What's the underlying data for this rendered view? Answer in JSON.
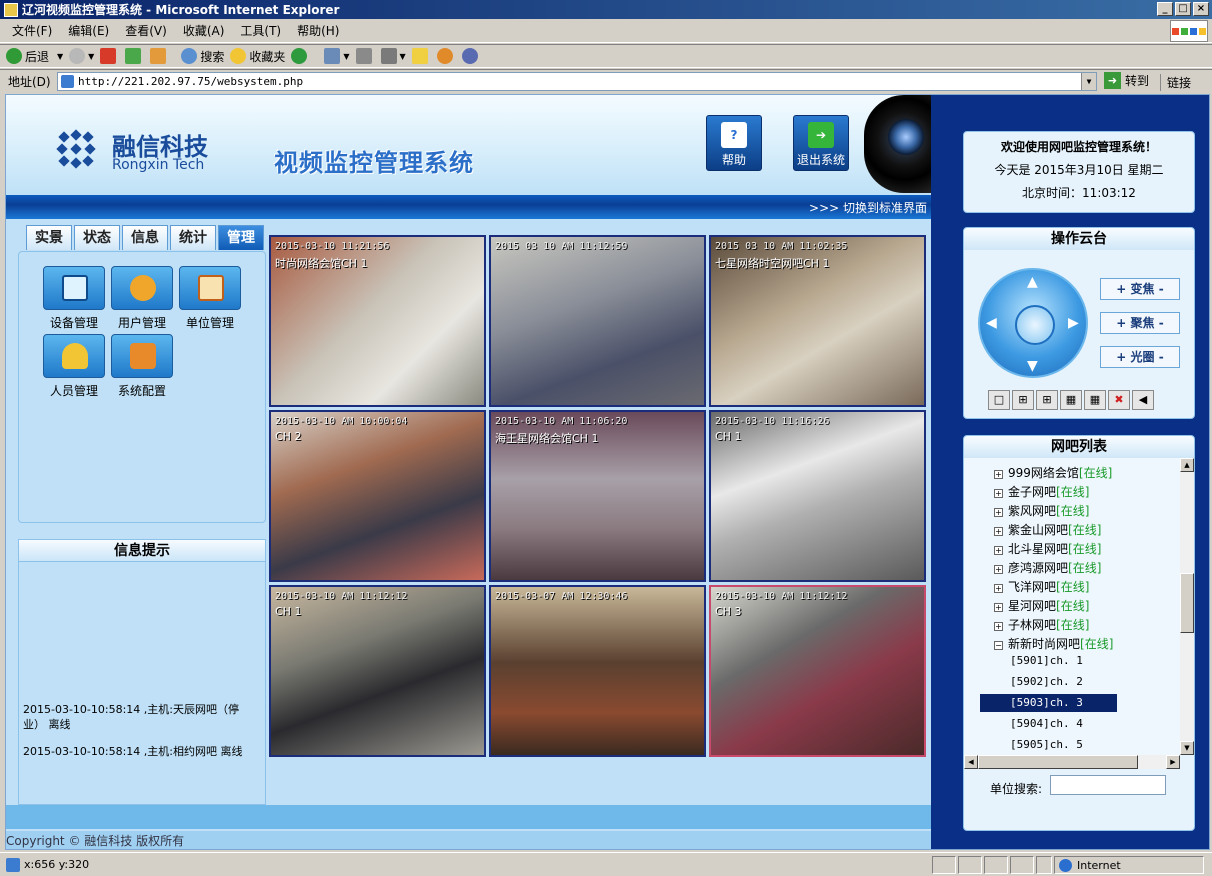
{
  "window": {
    "title": "辽河视频监控管理系统 - Microsoft Internet Explorer"
  },
  "menu": [
    "文件(F)",
    "编辑(E)",
    "查看(V)",
    "收藏(A)",
    "工具(T)",
    "帮助(H)"
  ],
  "toolbar": {
    "back": "后退",
    "search": "搜索",
    "favorites": "收藏夹"
  },
  "address": {
    "label": "地址(D)",
    "url": "http://221.202.97.75/websystem.php",
    "go": "转到",
    "links": "链接"
  },
  "header": {
    "company_cn": "融信科技",
    "company_en": "Rongxin Tech",
    "system_title": "视频监控管理系统",
    "help_label": "帮助",
    "logout_label": "退出系统",
    "switch_link": ">>> 切换到标准界面"
  },
  "tabs": [
    "实景",
    "状态",
    "信息",
    "统计",
    "管理"
  ],
  "tools": [
    {
      "label": "设备管理",
      "icon": "monitor-icon"
    },
    {
      "label": "用户管理",
      "icon": "user-key-icon"
    },
    {
      "label": "单位管理",
      "icon": "house-icon"
    },
    {
      "label": "人员管理",
      "icon": "people-icon"
    },
    {
      "label": "系统配置",
      "icon": "tools-icon"
    }
  ],
  "info": {
    "title": "信息提示",
    "messages": [
      "2015-03-10-10:58:14 ,主机:天辰网吧（停业） 离线",
      "2015-03-10-10:58:14 ,主机:相约网吧 离线"
    ]
  },
  "cameras": [
    {
      "timestamp": "2015-03-10 11:21:56",
      "label": "时尚网络会馆CH 1"
    },
    {
      "timestamp": "2015 03 10 AM 11:12:59",
      "label": ""
    },
    {
      "timestamp": "2015 03 10 AM 11:02:35",
      "label": "七星网络时空网吧CH 1"
    },
    {
      "timestamp": "2015-03-10 AM 10:00:04",
      "label": "CH 2"
    },
    {
      "timestamp": "2015-03-10 AM 11:06:20",
      "label": "海王星网络会馆CH 1"
    },
    {
      "timestamp": "2015-03-10 11:16:26",
      "label": "CH 1"
    },
    {
      "timestamp": "2015-03-10 AM 11:12:12",
      "label": "CH 1"
    },
    {
      "timestamp": "2015-03-07 AM 12:30:46",
      "label": ""
    },
    {
      "timestamp": "2015-03-10 AM 11:12:12",
      "label": "CH 3"
    }
  ],
  "copyright": "Copyright © 融信科技  版权所有",
  "welcome": {
    "title": "欢迎使用网吧监控管理系统！",
    "date": "今天是  2015年3月10日  星期二",
    "time": "北京时间：11:03:12"
  },
  "ptz": {
    "title": "操作云台",
    "zoom": "+ 变焦 -",
    "focus": "+ 聚焦 -",
    "iris": "+ 光圈 -"
  },
  "netbar": {
    "title": "网吧列表",
    "items": [
      {
        "name": "999网络会馆",
        "status": "[在线]"
      },
      {
        "name": "金子网吧",
        "status": "[在线]"
      },
      {
        "name": "紫风网吧",
        "status": "[在线]"
      },
      {
        "name": "紫金山网吧",
        "status": "[在线]"
      },
      {
        "name": "北斗星网吧",
        "status": "[在线]"
      },
      {
        "name": "彦鸿源网吧",
        "status": "[在线]"
      },
      {
        "name": "飞洋网吧",
        "status": "[在线]"
      },
      {
        "name": "星河网吧",
        "status": "[在线]"
      },
      {
        "name": "子林网吧",
        "status": "[在线]"
      },
      {
        "name": "新新时尚网吧",
        "status": "[在线]"
      }
    ],
    "channels": [
      "[5901]ch. 1",
      "[5902]ch. 2",
      "[5903]ch. 3",
      "[5904]ch. 4",
      "[5905]ch. 5"
    ],
    "search_label": "单位搜索:"
  },
  "statusbar": {
    "coords": "x:656 y:320",
    "zone": "Internet"
  },
  "colors": {
    "accent": "#0a3f95",
    "online": "#1a9a2a",
    "selected": "#0a246a"
  }
}
